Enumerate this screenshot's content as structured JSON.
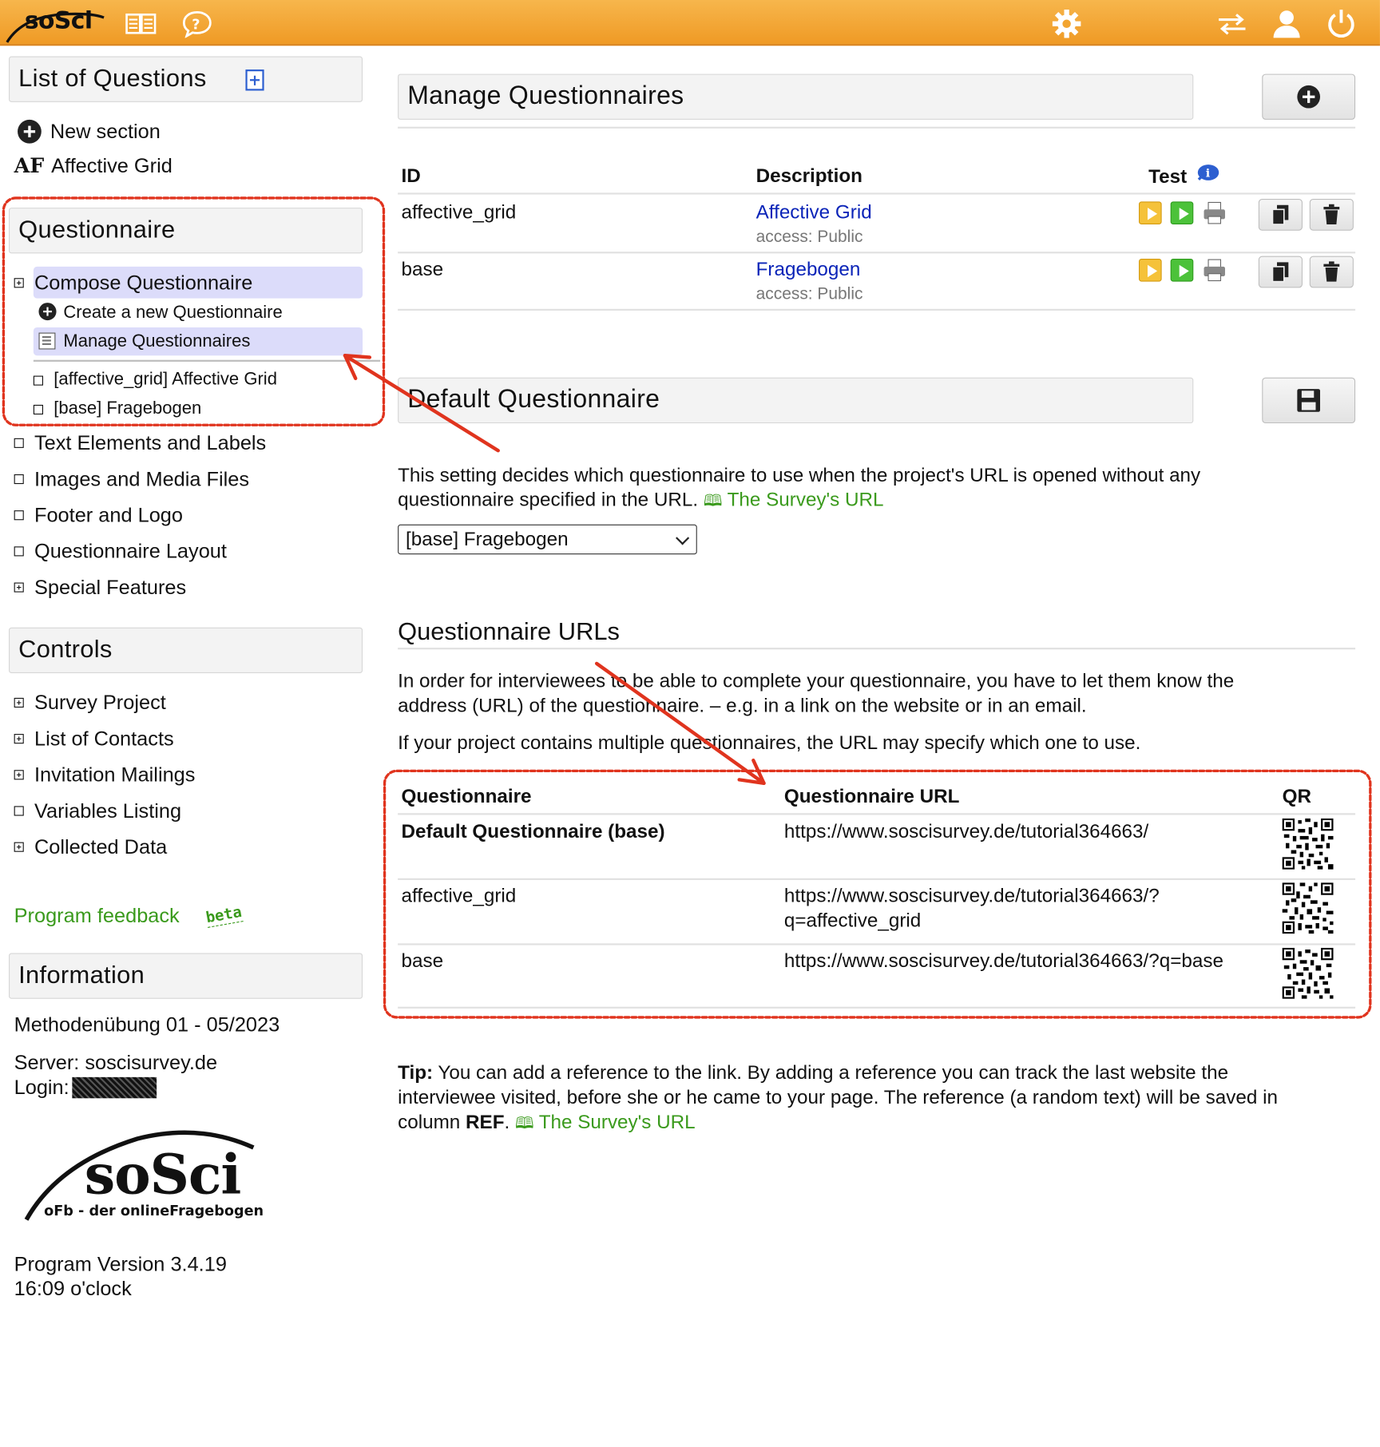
{
  "topbar": {
    "logo_text": "soSci",
    "icons": [
      "manual-icon",
      "help-icon",
      "settings-icon",
      "switch-icon",
      "user-icon",
      "logout-icon"
    ],
    "colors": {
      "bar": "#ef9a25"
    }
  },
  "sidebar": {
    "list_title": "List of Questions",
    "new_section": "New section",
    "af_badge": "AF",
    "affective_grid": "Affective Grid",
    "questionnaire_title": "Questionnaire",
    "compose": "Compose Questionnaire",
    "create_new": "Create a new Questionnaire",
    "manage": "Manage Questionnaires",
    "q_items": [
      "[affective_grid] Affective Grid",
      "[base] Fragebogen"
    ],
    "other_items": [
      "Text Elements and Labels",
      "Images and Media Files",
      "Footer and Logo",
      "Questionnaire Layout",
      "Special Features"
    ],
    "controls_title": "Controls",
    "control_items": [
      "Survey Project",
      "List of Contacts",
      "Invitation Mailings",
      "Variables Listing",
      "Collected Data"
    ],
    "feedback": "Program feedback",
    "beta": "beta",
    "info_title": "Information",
    "project": "Methodenübung 01 - 05/2023",
    "server": "Server: soscisurvey.de",
    "login": "Login:",
    "big_logo": "soSci",
    "big_logo_sub": "oFb - der onlineFragebogen",
    "version": "Program Version 3.4.19",
    "time": "16:09 o'clock"
  },
  "manage": {
    "title": "Manage Questionnaires",
    "headers": {
      "id": "ID",
      "description": "Description",
      "test": "Test"
    },
    "rows": [
      {
        "id": "affective_grid",
        "name": "Affective Grid",
        "access": "access: Public"
      },
      {
        "id": "base",
        "name": "Fragebogen",
        "access": "access: Public"
      }
    ]
  },
  "default_q": {
    "title": "Default Questionnaire",
    "desc1": "This setting decides which questionnaire to use when the project's URL is opened without any",
    "desc2": "questionnaire specified in the URL.",
    "help_link": "The Survey's URL",
    "select_value": "[base] Fragebogen"
  },
  "urls": {
    "title": "Questionnaire URLs",
    "p1a": "In order for interviewees to be able to complete your questionnaire, you have to let them know the",
    "p1b": "address (URL) of the questionnaire. – e.g. in a link on the website or in an email.",
    "p2": "If your project contains multiple questionnaires, the URL may specify which one to use.",
    "headers": {
      "q": "Questionnaire",
      "url": "Questionnaire URL",
      "qr": "QR"
    },
    "rows": [
      {
        "q": "Default Questionnaire (base)",
        "url1": "https://www.soscisurvey.de/tutorial364663/",
        "url2": ""
      },
      {
        "q": "affective_grid",
        "url1": "https://www.soscisurvey.de/tutorial364663/?",
        "url2": "q=affective_grid"
      },
      {
        "q": "base",
        "url1": "https://www.soscisurvey.de/tutorial364663/?q=base",
        "url2": ""
      }
    ]
  },
  "tip": {
    "label": "Tip:",
    "line1": "You can add a reference to the link. By adding a reference you can track the last website the",
    "line2": "interviewee visited, before she or he came to your page. The reference (a random text) will be saved in",
    "line3a": "column",
    "ref": "REF",
    "line3b": ".",
    "help_link": "The Survey's URL"
  }
}
